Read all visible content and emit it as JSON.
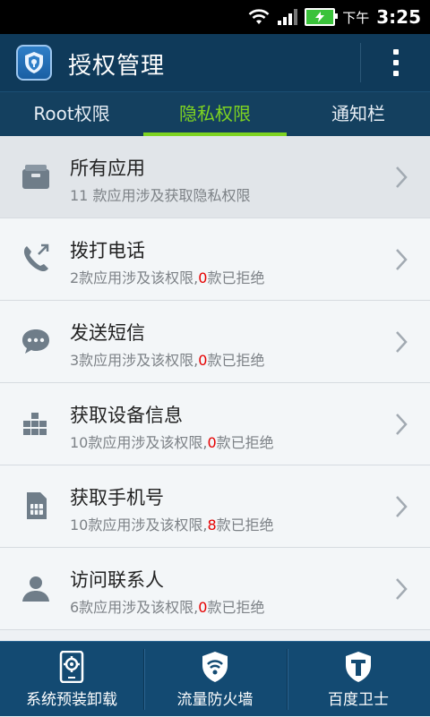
{
  "status_bar": {
    "ampm": "下午",
    "time": "3:25"
  },
  "app_bar": {
    "title": "授权管理"
  },
  "tabs": [
    {
      "label": "Root权限",
      "active": false
    },
    {
      "label": "隐私权限",
      "active": true
    },
    {
      "label": "通知栏",
      "active": false
    }
  ],
  "permissions": [
    {
      "icon": "app-box-icon",
      "title": "所有应用",
      "subtitle": "11 款应用涉及获取隐私权限"
    },
    {
      "icon": "phone-call-icon",
      "title": "拨打电话",
      "count_text": "2款应用涉及该权限,",
      "rejected": "0",
      "rejected_suffix": "款已拒绝"
    },
    {
      "icon": "sms-bubble-icon",
      "title": "发送短信",
      "count_text": "3款应用涉及该权限,",
      "rejected": "0",
      "rejected_suffix": "款已拒绝"
    },
    {
      "icon": "device-grid-icon",
      "title": "获取设备信息",
      "count_text": "10款应用涉及该权限,",
      "rejected": "0",
      "rejected_suffix": "款已拒绝"
    },
    {
      "icon": "sim-card-icon",
      "title": "获取手机号",
      "count_text": "10款应用涉及该权限,",
      "rejected": "8",
      "rejected_suffix": "款已拒绝"
    },
    {
      "icon": "contact-person-icon",
      "title": "访问联系人",
      "count_text": "6款应用涉及该权限,",
      "rejected": "0",
      "rejected_suffix": "款已拒绝"
    }
  ],
  "bottom_bar": [
    {
      "icon": "system-uninstall-icon",
      "label": "系统预装卸载"
    },
    {
      "icon": "wifi-shield-icon",
      "label": "流量防火墙"
    },
    {
      "icon": "guard-shield-icon",
      "label": "百度卫士"
    }
  ],
  "colors": {
    "accent": "#7ed321",
    "header": "#0f3a5a",
    "rejected": "#e60000"
  }
}
